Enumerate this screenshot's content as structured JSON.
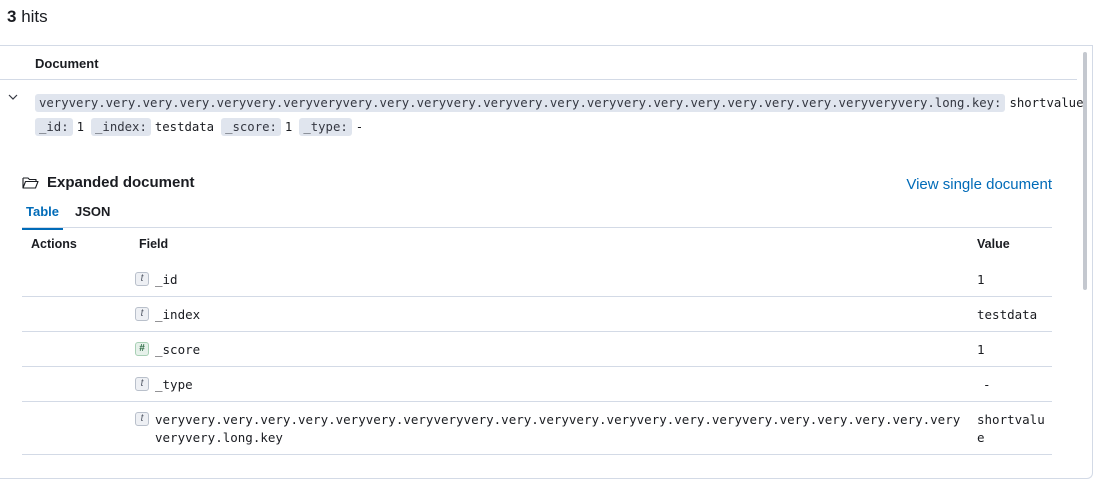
{
  "hits": {
    "count": "3",
    "label": "hits"
  },
  "doc_table": {
    "column": "Document"
  },
  "summary": {
    "long_key": "veryvery.very.very.very.veryvery.veryveryvery.very.veryvery.veryvery.very.veryvery.very.very.very.very.very.veryveryvery.long.key:",
    "long_val": "shortvalue",
    "id_key": "_id:",
    "id_val": "1",
    "index_key": "_index:",
    "index_val": "testdata",
    "score_key": "_score:",
    "score_val": "1",
    "type_key": "_type:",
    "type_val": "-"
  },
  "expanded": {
    "title": "Expanded document",
    "view_single": "View single document",
    "tabs": [
      "Table",
      "JSON"
    ],
    "headers": {
      "actions": "Actions",
      "field": "Field",
      "value": "Value"
    },
    "rows": [
      {
        "type": "t",
        "field": "_id",
        "value": "1"
      },
      {
        "type": "t",
        "field": "_index",
        "value": "testdata"
      },
      {
        "type": "#",
        "field": "_score",
        "value": "1"
      },
      {
        "type": "t",
        "field": "_type",
        "value": "-"
      },
      {
        "type": "t",
        "field_line1": "veryvery.very.very.very.veryvery.veryveryvery.very.veryvery.veryvery.very.veryvery.very.very.very.very.very",
        "field_line2": "veryvery.long.key",
        "value_line1": "shortvalu",
        "value_line2": "e"
      }
    ]
  }
}
